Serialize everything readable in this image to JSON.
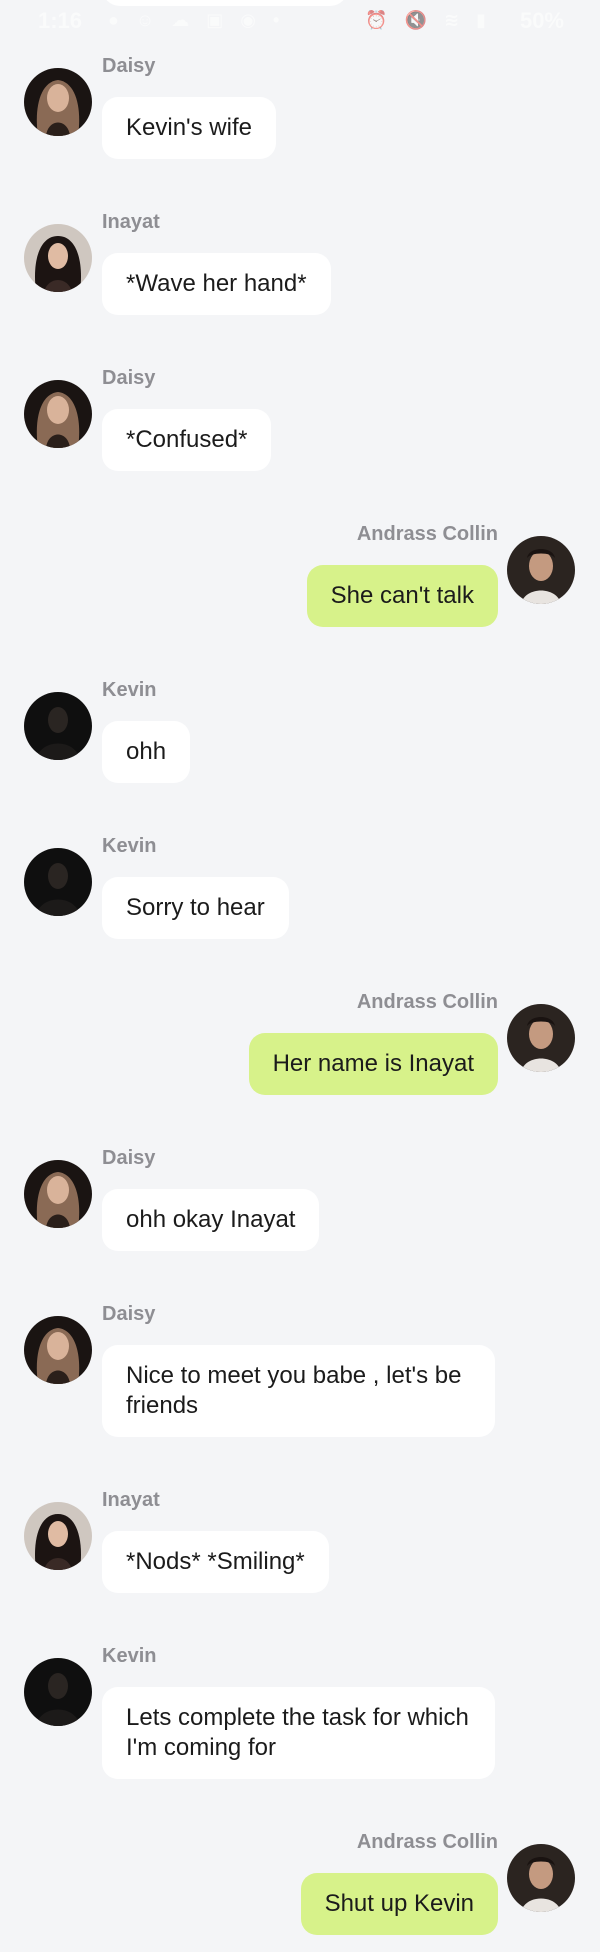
{
  "status_bar": {
    "time": "1:16",
    "battery": "50%"
  },
  "colors": {
    "background": "#f4f5f7",
    "incoming_bubble": "#ffffff",
    "outgoing_bubble": "#d7f28a",
    "sender_name": "#8e8e93"
  },
  "messages": [
    {
      "sender": "Daisy",
      "text": "Kevin's wife",
      "side": "left",
      "avatar": "daisy-avatar"
    },
    {
      "sender": "Inayat",
      "text": "*Wave her hand*",
      "side": "left",
      "avatar": "inayat-avatar"
    },
    {
      "sender": "Daisy",
      "text": "*Confused*",
      "side": "left",
      "avatar": "daisy-avatar"
    },
    {
      "sender": "Andrass Collin",
      "text": "She can't talk",
      "side": "right",
      "avatar": "andrass-avatar"
    },
    {
      "sender": "Kevin",
      "text": "ohh",
      "side": "left",
      "avatar": "kevin-avatar"
    },
    {
      "sender": "Kevin",
      "text": "Sorry to hear",
      "side": "left",
      "avatar": "kevin-avatar"
    },
    {
      "sender": "Andrass Collin",
      "text": "Her name is Inayat",
      "side": "right",
      "avatar": "andrass-avatar"
    },
    {
      "sender": "Daisy",
      "text": "ohh okay Inayat",
      "side": "left",
      "avatar": "daisy-avatar"
    },
    {
      "sender": "Daisy",
      "text": "Nice to meet you babe , let's be friends",
      "side": "left",
      "avatar": "daisy-avatar"
    },
    {
      "sender": "Inayat",
      "text": "*Nods* *Smiling*",
      "side": "left",
      "avatar": "inayat-avatar"
    },
    {
      "sender": "Kevin",
      "text": "Lets complete the task for which I'm coming for",
      "side": "left",
      "avatar": "kevin-avatar"
    },
    {
      "sender": "Andrass Collin",
      "text": "Shut up Kevin",
      "side": "right",
      "avatar": "andrass-avatar"
    }
  ]
}
